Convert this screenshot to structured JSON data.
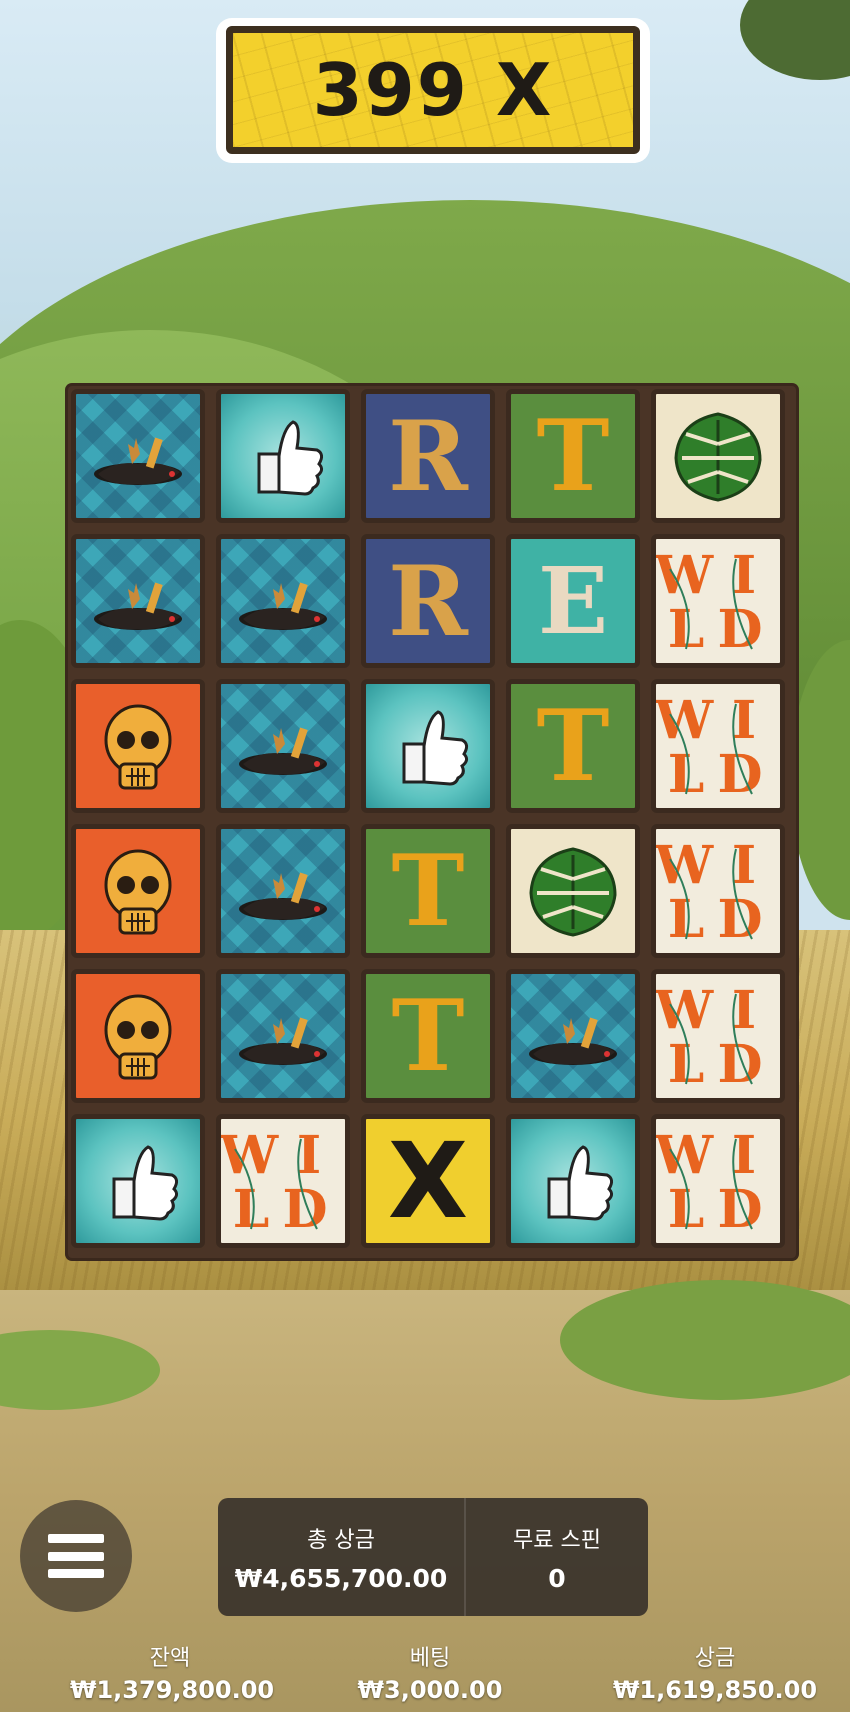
{
  "multiplier": {
    "text": "399 X"
  },
  "board": {
    "rows": [
      [
        "chicken",
        "thumbs-up",
        "R",
        "T",
        "leaf"
      ],
      [
        "chicken",
        "chicken",
        "R",
        "E",
        "wild"
      ],
      [
        "skull",
        "chicken",
        "thumbs-up",
        "T",
        "wild"
      ],
      [
        "skull",
        "chicken",
        "T",
        "leaf",
        "wild"
      ],
      [
        "skull",
        "chicken",
        "T",
        "chicken",
        "wild"
      ],
      [
        "thumbs-up",
        "wild",
        "X",
        "thumbs-up",
        "wild"
      ]
    ],
    "letters": {
      "R": "R",
      "T": "T",
      "E": "E",
      "X": "X"
    },
    "colors": {
      "orange": "#e8641f",
      "gold": "#e9a21b",
      "dark": "#1f1b16"
    }
  },
  "summary": {
    "total_win_label": "총 상금",
    "total_win_value": "₩4,655,700.00",
    "free_spins_label": "무료 스핀",
    "free_spins_value": "0"
  },
  "footer": {
    "balance_label": "잔액",
    "balance_value": "₩1,379,800.00",
    "bet_label": "베팅",
    "bet_value": "₩3,000.00",
    "win_label": "상금",
    "win_value": "₩1,619,850.00"
  },
  "menu": {
    "icon": "hamburger-menu-icon"
  }
}
